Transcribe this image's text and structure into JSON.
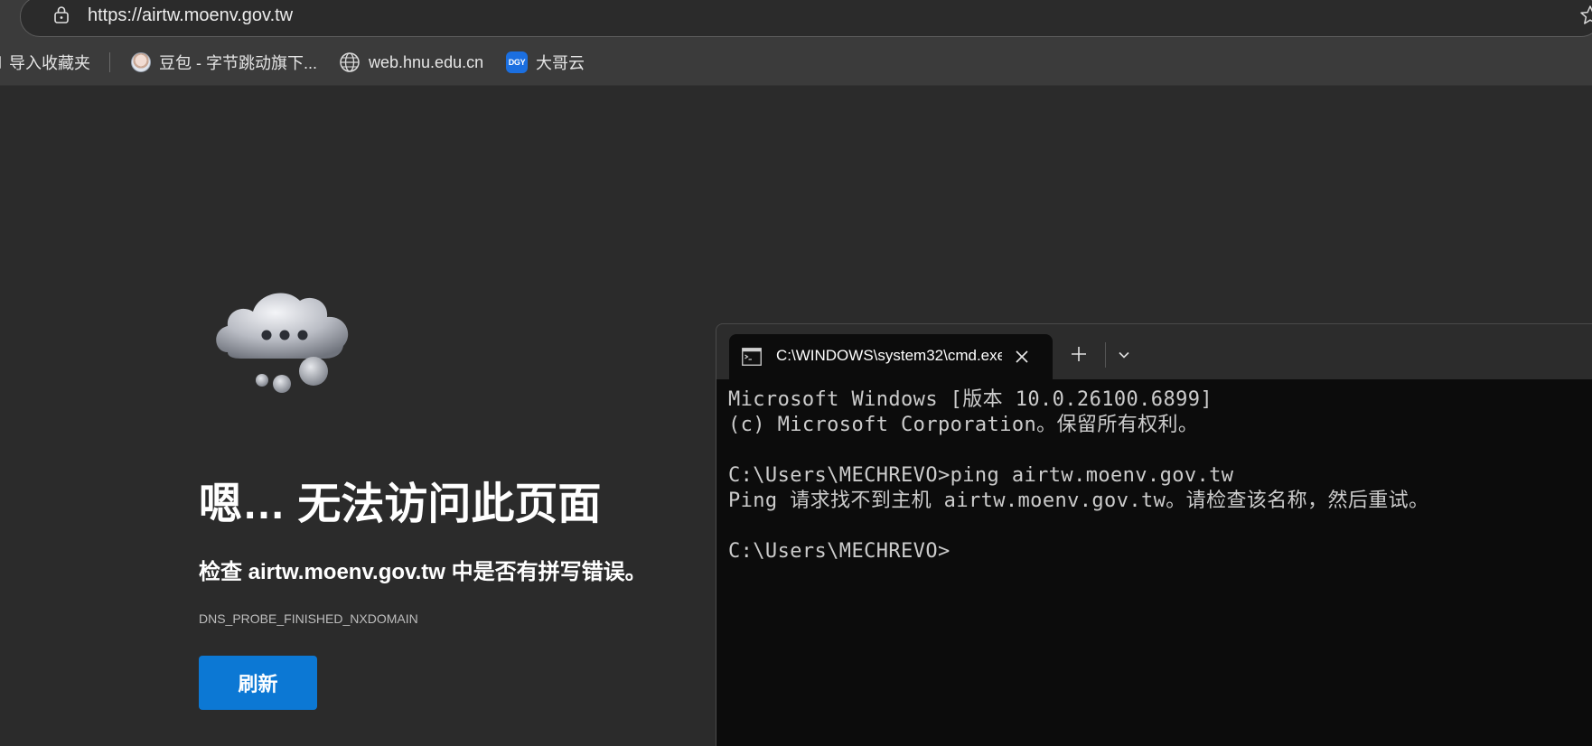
{
  "address_bar": {
    "url": "https://airtw.moenv.gov.tw"
  },
  "bookmarks": [
    {
      "label": "导入收藏夹",
      "icon": "folder-icon"
    },
    {
      "label": "豆包 - 字节跳动旗下...",
      "icon": "avatar-icon"
    },
    {
      "label": "web.hnu.edu.cn",
      "icon": "globe-icon"
    },
    {
      "label": "大哥云",
      "icon": "dgy-logo-icon",
      "icon_text": "DGY"
    }
  ],
  "error_page": {
    "title": "嗯… 无法访问此页面",
    "description": "检查 airtw.moenv.gov.tw 中是否有拼写错误。",
    "error_code": "DNS_PROBE_FINISHED_NXDOMAIN",
    "refresh_label": "刷新"
  },
  "terminal": {
    "tab_title": "C:\\WINDOWS\\system32\\cmd.exe",
    "lines": [
      "Microsoft Windows [版本 10.0.26100.6899]",
      "(c) Microsoft Corporation。保留所有权利。",
      "",
      "C:\\Users\\MECHREVO>ping airtw.moenv.gov.tw",
      "Ping 请求找不到主机 airtw.moenv.gov.tw。请检查该名称，然后重试。",
      "",
      "C:\\Users\\MECHREVO>"
    ]
  },
  "colors": {
    "page_background": "#2b2b2b",
    "toolbar_background": "#3b3b3b",
    "button_accent": "#0c78d4",
    "terminal_background": "#0c0c0c",
    "terminal_text": "#cccccc"
  }
}
